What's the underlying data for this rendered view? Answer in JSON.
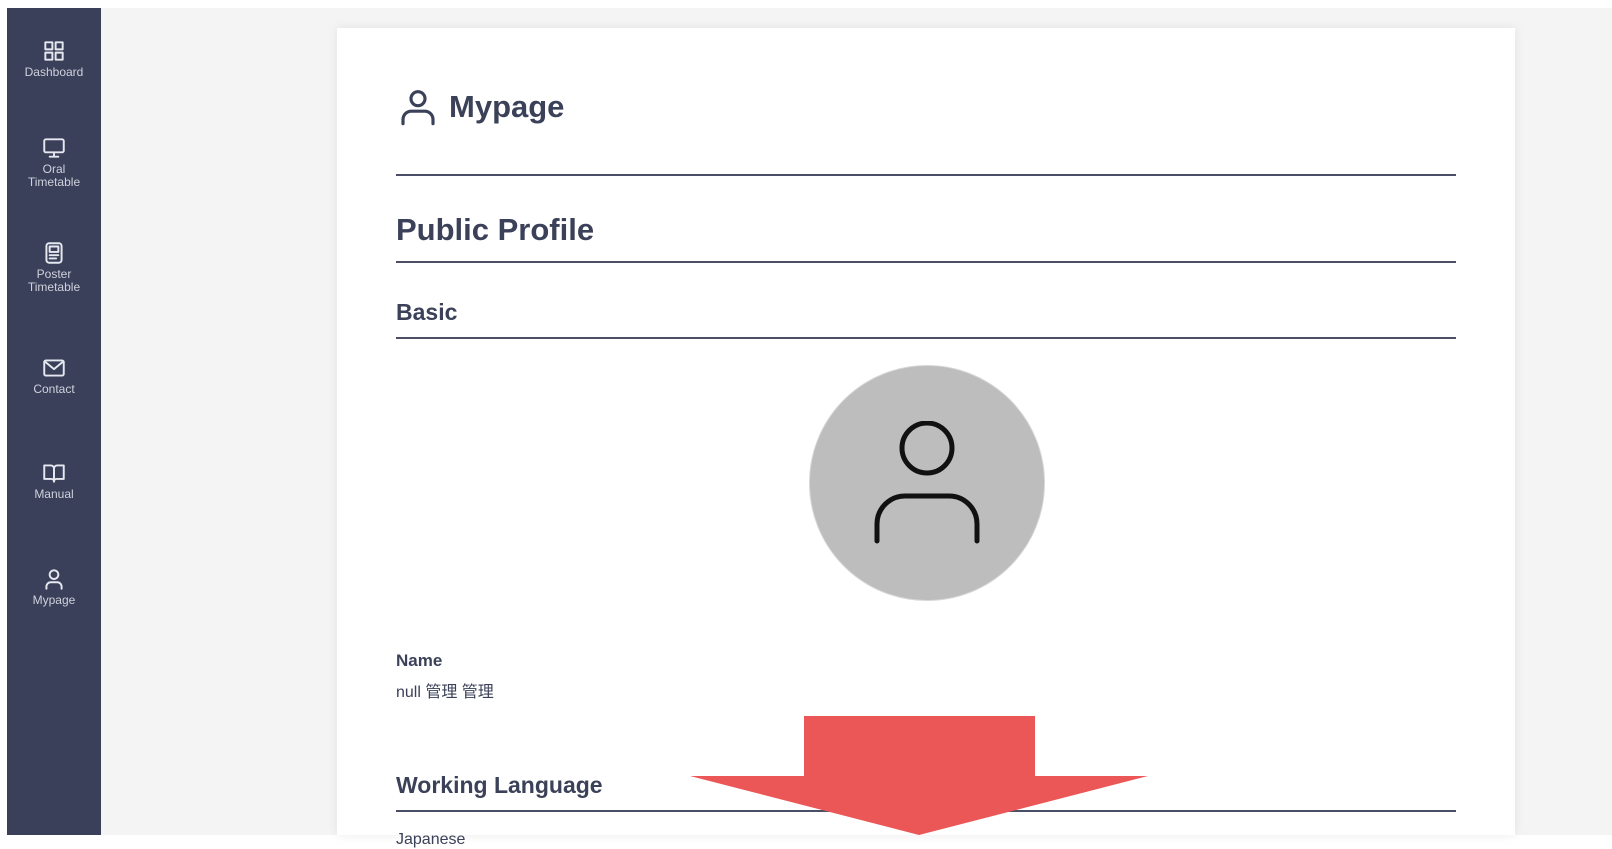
{
  "sidebar": {
    "items": [
      {
        "label": "Dashboard",
        "icon": "grid-icon"
      },
      {
        "label": "Oral\nTimetable",
        "icon": "monitor-icon"
      },
      {
        "label": "Poster\nTimetable",
        "icon": "poster-icon"
      },
      {
        "label": "Contact",
        "icon": "mail-icon"
      },
      {
        "label": "Manual",
        "icon": "book-icon"
      },
      {
        "label": "Mypage",
        "icon": "user-icon"
      }
    ]
  },
  "page": {
    "title": "Mypage",
    "section_title": "Public Profile",
    "basic_heading": "Basic",
    "name_label": "Name",
    "name_value": "null 管理 管理",
    "working_language_heading": "Working Language",
    "working_language_value": "Japanese"
  },
  "colors": {
    "sidebar_bg": "#3a3f5a",
    "heading_text": "#3b4158",
    "avatar_bg": "#bdbdbd",
    "arrow": "#eb5757"
  }
}
